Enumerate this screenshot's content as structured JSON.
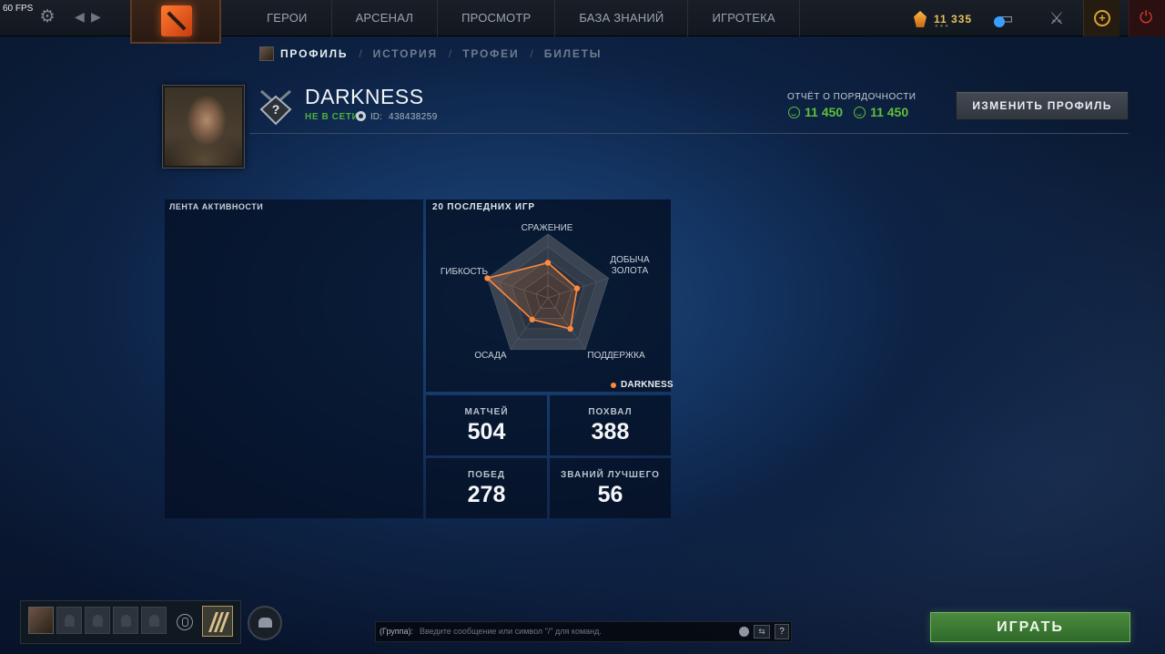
{
  "topbar": {
    "fps": "60 FPS",
    "nav": [
      "ГЕРОИ",
      "АРСЕНАЛ",
      "ПРОСМОТР",
      "БАЗА ЗНАНИЙ",
      "ИГРОТЕКА"
    ],
    "currency": "11 335"
  },
  "subnav": {
    "items": [
      "ПРОФИЛЬ",
      "ИСТОРИЯ",
      "ТРОФЕИ",
      "БИЛЕТЫ"
    ],
    "separator": "/"
  },
  "profile": {
    "name": "DARKNESS",
    "status": "НЕ В СЕТИ",
    "id_label": "ID:",
    "id_value": "438438259",
    "conduct_label": "ОТЧЁТ О ПОРЯДОЧНОСТИ",
    "conduct_value_1": "11 450",
    "conduct_value_2": "11 450",
    "edit_button": "ИЗМЕНИТЬ ПРОФИЛЬ"
  },
  "feed": {
    "title": "ЛЕНТА АКТИВНОСТИ"
  },
  "radar": {
    "title": "20 ПОСЛЕДНИХ ИГР",
    "axes": [
      "СРАЖЕНИЕ",
      "ДОБЫЧА ЗОЛОТА",
      "ПОДДЕРЖКА",
      "ОСАДА",
      "ГИБКОСТЬ"
    ],
    "legend": "DARKNESS",
    "series_color": "#ff8a3c"
  },
  "chart_data": {
    "type": "radar",
    "title": "20 ПОСЛЕДНИХ ИГР",
    "axes": [
      "СРАЖЕНИЕ",
      "ДОБЫЧА ЗОЛОТА",
      "ПОДДЕРЖКА",
      "ОСАДА",
      "ГИБКОСТЬ"
    ],
    "series": [
      {
        "name": "DARKNESS",
        "values": [
          0.55,
          0.48,
          0.6,
          0.42,
          1.0
        ]
      }
    ],
    "range": [
      0,
      1
    ]
  },
  "stats": {
    "matches_label": "МАТЧЕЙ",
    "matches": "504",
    "commends_label": "ПОХВАЛ",
    "commends": "388",
    "wins_label": "ПОБЕД",
    "wins": "278",
    "mvp_label": "ЗВАНИЙ ЛУЧШЕГО",
    "mvp": "56"
  },
  "chat": {
    "channel": "(Группа):",
    "placeholder": "Введите сообщение или символ \"/\" для команд.",
    "help": "?"
  },
  "play_button": "ИГРАТЬ"
}
